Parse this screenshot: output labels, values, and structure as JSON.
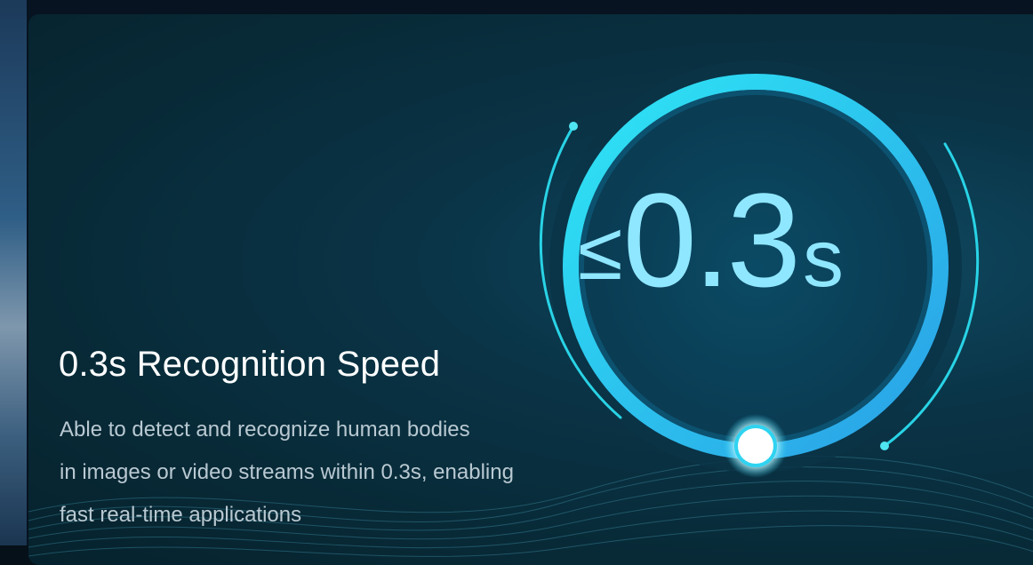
{
  "feature": {
    "title": "0.3s Recognition Speed",
    "description_lines": [
      "Able to detect and recognize human bodies",
      "in images or video streams within 0.3s, enabling",
      "fast real-time applications"
    ]
  },
  "gauge": {
    "comparator": "≤",
    "value": "0.3",
    "unit": "s"
  },
  "colors": {
    "ring_primary": "#22d6f2",
    "ring_secondary": "#2aa6e8",
    "background": "#082a37",
    "text_primary": "#ffffff",
    "text_secondary": "#b9c9d2"
  }
}
